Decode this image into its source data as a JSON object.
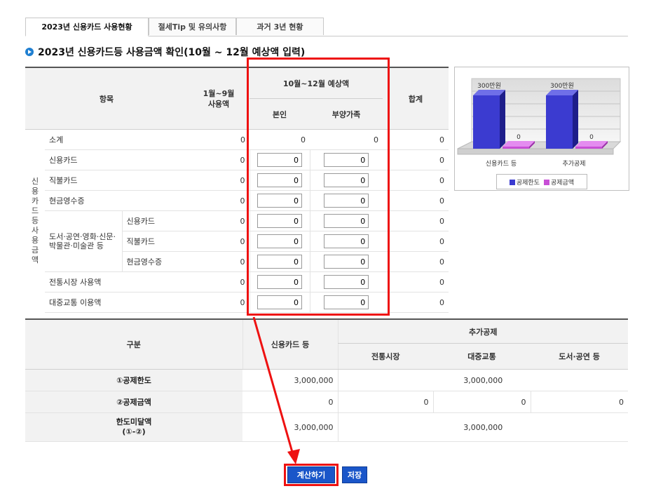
{
  "tabs": [
    {
      "label": "2023년 신용카드 사용현황"
    },
    {
      "label": "절세Tip 및 유의사항"
    },
    {
      "label": "과거 3년 현황"
    }
  ],
  "section_title": "2023년 신용카드등 사용금액 확인(10월 ~ 12월 예상액 입력)",
  "usage_table": {
    "headers": {
      "item": "항목",
      "jan_sep": "1월~9월\n사용액",
      "oct_dec": "10월~12월 예상액",
      "self": "본인",
      "dependents": "부양가족",
      "total": "합계"
    },
    "group_label": "신용카드등 사용금액",
    "culture_label": "도서·공연·영화·신문·박물관·미술관 등",
    "rows": [
      {
        "label": "소계",
        "jan_sep": "0",
        "self": "0",
        "dep": "0",
        "total": "0"
      },
      {
        "label": "신용카드",
        "jan_sep": "0",
        "self": "0",
        "dep": "0",
        "total": "0"
      },
      {
        "label": "직불카드",
        "jan_sep": "0",
        "self": "0",
        "dep": "0",
        "total": "0"
      },
      {
        "label": "현금영수증",
        "jan_sep": "0",
        "self": "0",
        "dep": "0",
        "total": "0"
      },
      {
        "label": "신용카드",
        "jan_sep": "0",
        "self": "0",
        "dep": "0",
        "total": "0"
      },
      {
        "label": "직불카드",
        "jan_sep": "0",
        "self": "0",
        "dep": "0",
        "total": "0"
      },
      {
        "label": "현금영수증",
        "jan_sep": "0",
        "self": "0",
        "dep": "0",
        "total": "0"
      },
      {
        "label": "전통시장 사용액",
        "jan_sep": "0",
        "self": "0",
        "dep": "0",
        "total": "0"
      },
      {
        "label": "대중교통 이용액",
        "jan_sep": "0",
        "self": "0",
        "dep": "0",
        "total": "0"
      }
    ]
  },
  "chart_data": {
    "type": "bar",
    "categories": [
      "신용카드 등",
      "추가공제"
    ],
    "series": [
      {
        "name": "공제한도",
        "values": [
          300,
          300
        ],
        "labels": [
          "300만원",
          "300만원"
        ],
        "color": "#3b3bd0"
      },
      {
        "name": "공제금액",
        "values": [
          0,
          0
        ],
        "labels": [
          "0",
          "0"
        ],
        "color": "#c84fd6"
      }
    ],
    "ylim": [
      0,
      300
    ]
  },
  "deduction_table": {
    "headers": {
      "category": "구분",
      "credit": "신용카드 등",
      "additional": "추가공제",
      "market": "전통시장",
      "transit": "대중교통",
      "culture": "도서·공연 등"
    },
    "rows": [
      {
        "label": "①공제한도",
        "credit": "3,000,000",
        "additional": "3,000,000"
      },
      {
        "label": "②공제금액",
        "credit": "0",
        "market": "0",
        "transit": "0",
        "culture": "0"
      },
      {
        "label": "한도미달액\n(①-②)",
        "credit": "3,000,000",
        "additional": "3,000,000"
      }
    ]
  },
  "buttons": {
    "calculate": "계산하기",
    "save": "저장"
  },
  "colors": {
    "accent": "#1a56c9",
    "highlight": "#e11111"
  }
}
